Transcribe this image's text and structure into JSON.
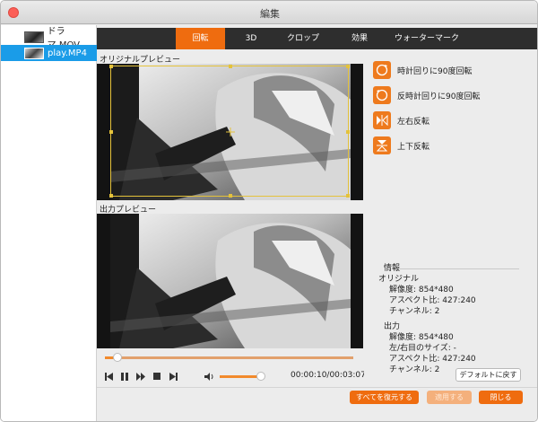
{
  "window": {
    "title": "編集"
  },
  "files": [
    {
      "name": "ドラマ.MOV",
      "selected": false
    },
    {
      "name": "play.MP4",
      "selected": true
    }
  ],
  "tabs": [
    {
      "label": "回転",
      "active": true
    },
    {
      "label": "3D",
      "active": false
    },
    {
      "label": "クロップ",
      "active": false
    },
    {
      "label": "効果",
      "active": false
    },
    {
      "label": "ウォーターマーク",
      "active": false
    }
  ],
  "preview": {
    "original_label": "オリジナルプレビュー",
    "output_label": "出力プレビュー"
  },
  "playback": {
    "time": "00:00:10/00:03:07",
    "progress_fraction": 0.05,
    "volume_fraction": 0.85
  },
  "actions": [
    {
      "label": "時計回りに90度回転",
      "icon": "rotate-clockwise-icon",
      "glyph": "90"
    },
    {
      "label": "反時計回りに90度回転",
      "icon": "rotate-counterclockwise-icon",
      "glyph": "90"
    },
    {
      "label": "左右反転",
      "icon": "flip-horizontal-icon",
      "glyph": ""
    },
    {
      "label": "上下反転",
      "icon": "flip-vertical-icon",
      "glyph": ""
    }
  ],
  "info": {
    "heading": "情報",
    "original": {
      "label": "オリジナル",
      "resolution": "解像度: 854*480",
      "aspect": "アスペクト比: 427:240",
      "channels": "チャンネル: 2"
    },
    "output": {
      "label": "出力",
      "resolution": "解像度: 854*480",
      "side_size": "左/右目のサイズ: -",
      "aspect": "アスペクト比: 427:240",
      "channels": "チャンネル: 2"
    }
  },
  "buttons": {
    "reset_default": "デフォルトに戻す",
    "restore_all": "すべてを復元する",
    "apply": "適用する",
    "close": "閉じる"
  },
  "colors": {
    "accent": "#ef6c0f",
    "selection": "#1a9ce8",
    "crop": "#e4c23b"
  }
}
